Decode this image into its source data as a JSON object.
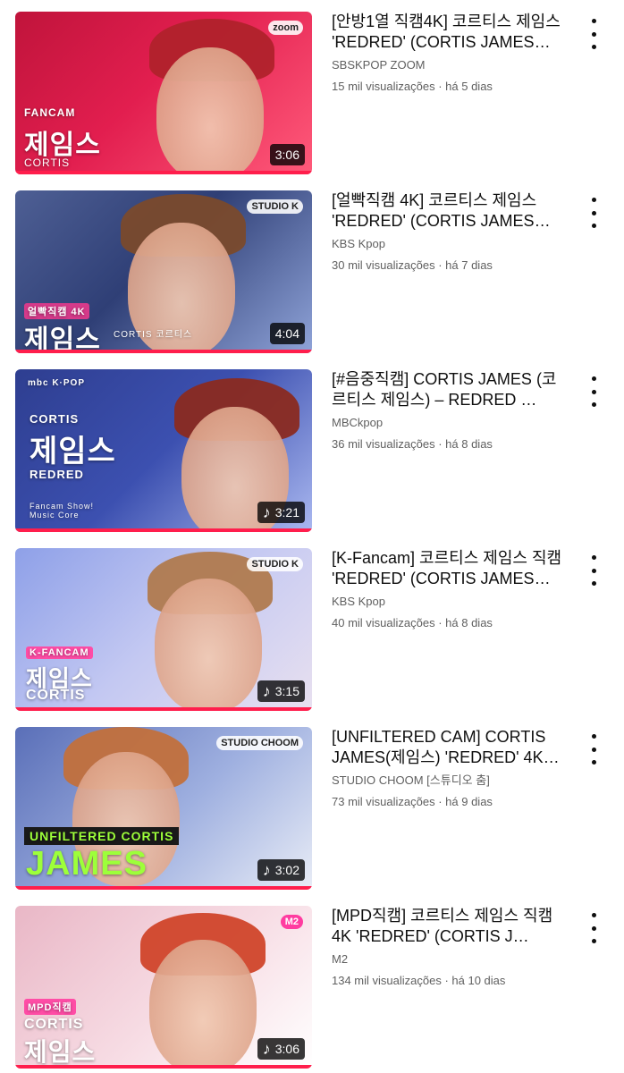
{
  "videos": [
    {
      "title": "[안방1열 직캠4K] 코르티스 제임스 'REDRED' (CORTIS JAMES…",
      "channel": "SBSKPOP ZOOM",
      "stats": "15 mil visualizações · há 5 dias",
      "duration": "3:06",
      "music_icon": false,
      "logo": "zoom",
      "overlay_lines": [
        "FANCAM",
        "제임스",
        "CORTIS"
      ]
    },
    {
      "title": "[얼빡직캠 4K] 코르티스 제임스 'REDRED' (CORTIS JAMES…",
      "channel": "KBS Kpop",
      "stats": "30 mil visualizações · há 7 dias",
      "duration": "4:04",
      "music_icon": false,
      "logo": "STUDIO K",
      "overlay_lines": [
        "얼빡직캠 4K",
        "제임스",
        "CORTIS 코르티스"
      ]
    },
    {
      "title": "[#음중직캠] CORTIS JAMES (코르티스 제임스) – REDRED …",
      "channel": "MBCkpop",
      "stats": "36 mil visualizações · há 8 dias",
      "duration": "3:21",
      "music_icon": true,
      "logo": "mbc K·POP",
      "overlay_lines": [
        "CORTIS",
        "제임스",
        "REDRED",
        "Fancam Show! Music Core"
      ]
    },
    {
      "title": "[K-Fancam] 코르티스 제임스 직캠 'REDRED' (CORTIS JAMES…",
      "channel": "KBS Kpop",
      "stats": "40 mil visualizações · há 8 dias",
      "duration": "3:15",
      "music_icon": true,
      "logo": "STUDIO K",
      "overlay_lines": [
        "K-FANCAM",
        "제임스",
        "CORTIS"
      ]
    },
    {
      "title": "[UNFILTERED CAM] CORTIS JAMES(제임스) 'REDRED' 4K |…",
      "channel": "STUDIO CHOOM [스튜디오 춤]",
      "stats": "73 mil visualizações · há 9 dias",
      "duration": "3:02",
      "music_icon": true,
      "logo": "STUDIO CHOOM",
      "overlay_lines": [
        "UNFILTERED CORTIS",
        "JAMES"
      ]
    },
    {
      "title": "[MPD직캠] 코르티스 제임스 직캠 4K 'REDRED' (CORTIS J…",
      "channel": "M2",
      "stats": "134 mil visualizações · há 10 dias",
      "duration": "3:06",
      "music_icon": true,
      "logo": "M2",
      "overlay_lines": [
        "MPD직캠",
        "CORTIS",
        "제임스"
      ]
    }
  ]
}
